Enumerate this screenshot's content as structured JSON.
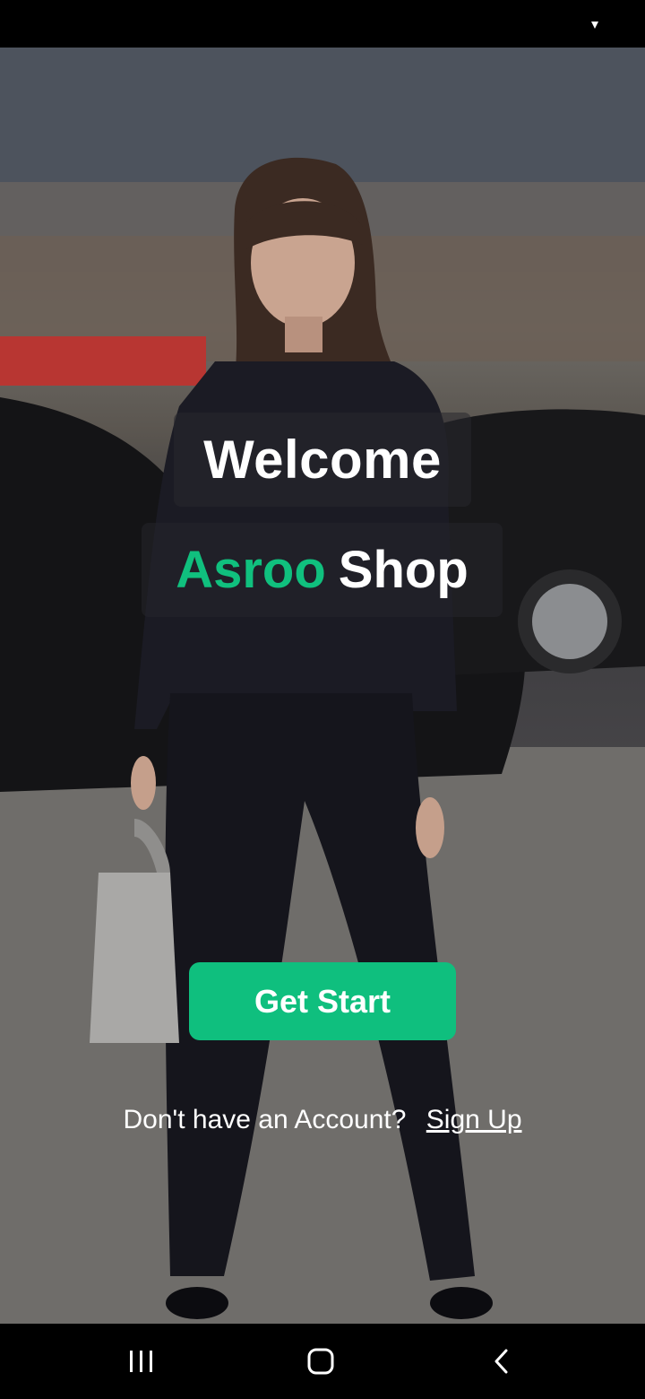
{
  "status_bar": {
    "signal_icon": "signal-icon"
  },
  "hero": {
    "description_icon": "hero-photo"
  },
  "welcome": {
    "title": "Welcome"
  },
  "brand": {
    "accent": "Asroo",
    "rest": "Shop",
    "accent_color": "#10c07e"
  },
  "cta": {
    "label": "Get Start",
    "color": "#0fbf7e"
  },
  "signup": {
    "prompt": "Don't have an Account?",
    "link": "Sign Up"
  },
  "nav": {
    "recents_icon": "recents-icon",
    "home_icon": "home-icon",
    "back_icon": "back-icon"
  }
}
